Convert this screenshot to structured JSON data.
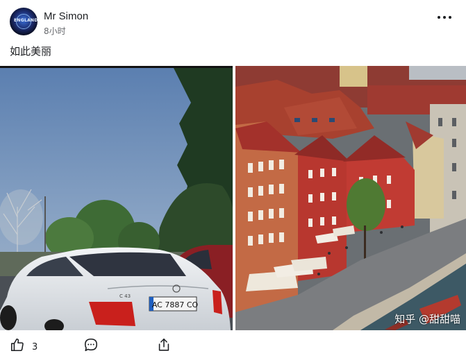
{
  "post": {
    "author": "Mr Simon",
    "timestamp": "8小时",
    "caption": "如此美丽",
    "avatar_text": "ENGLAND",
    "like_count": "3",
    "watermark": "知乎 @甜甜喵"
  },
  "photos": {
    "left": {
      "plate": "AC 7887 CO",
      "badge": "C 43"
    }
  },
  "icons": {
    "more": "more-horizontal-icon",
    "like": "thumbs-up-icon",
    "comment": "comment-bubble-icon",
    "share": "share-icon"
  },
  "colors": {
    "text": "#1c1e21",
    "muted": "#65676b"
  }
}
